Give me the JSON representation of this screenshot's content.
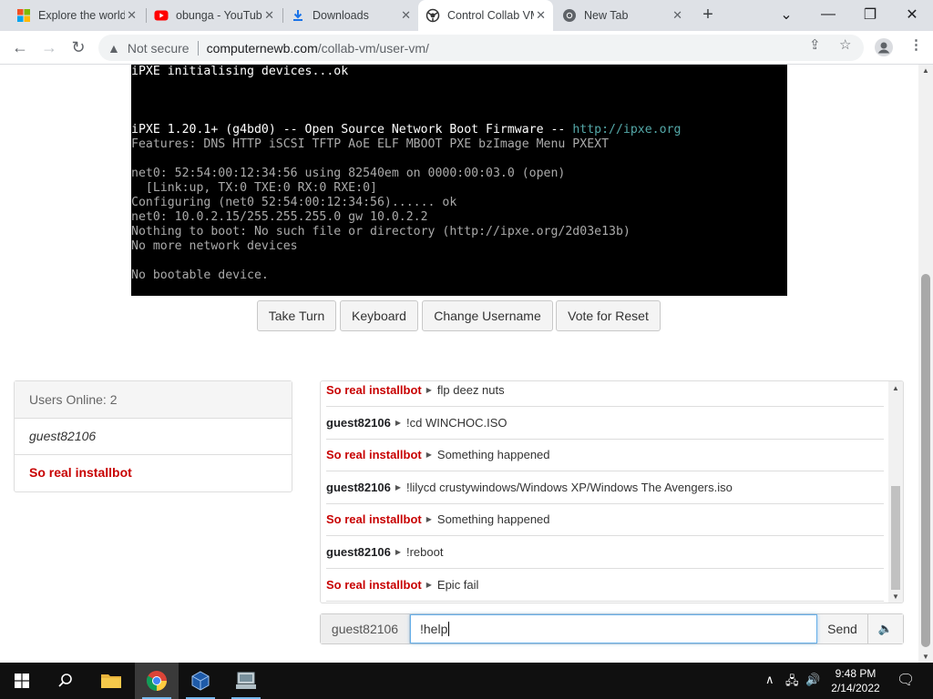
{
  "browser": {
    "tabs": [
      {
        "title": "Explore the world"
      },
      {
        "title": "obunga - YouTube"
      },
      {
        "title": "Downloads"
      },
      {
        "title": "Control Collab VM"
      },
      {
        "title": "New Tab"
      }
    ],
    "url_warning": "Not secure",
    "url_domain": "computernewb.com",
    "url_path": "/collab-vm/user-vm/"
  },
  "vm_console": {
    "lines": [
      "iPXE initialising devices...ok",
      "",
      "",
      "",
      "iPXE 1.20.1+ (g4bd0) -- Open Source Network Boot Firmware -- ",
      "Features: DNS HTTP iSCSI TFTP AoE ELF MBOOT PXE bzImage Menu PXEXT",
      "",
      "net0: 52:54:00:12:34:56 using 82540em on 0000:00:03.0 (open)",
      "  [Link:up, TX:0 TXE:0 RX:0 RXE:0]",
      "Configuring (net0 52:54:00:12:34:56)...... ok",
      "net0: 10.0.2.15/255.255.255.0 gw 10.0.2.2",
      "Nothing to boot: No such file or directory (http://ipxe.org/2d03e13b)",
      "No more network devices",
      "",
      "No bootable device."
    ],
    "link": "http://ipxe.org"
  },
  "buttons": {
    "take_turn": "Take Turn",
    "keyboard": "Keyboard",
    "change_username": "Change Username",
    "vote_reset": "Vote for Reset"
  },
  "users": {
    "header": "Users Online: 2",
    "list": [
      {
        "name": "guest82106"
      },
      {
        "name": "So real installbot"
      }
    ]
  },
  "chat": {
    "messages": [
      {
        "user": "So real installbot",
        "text": "flp deez nuts",
        "bot": true
      },
      {
        "user": "guest82106",
        "text": "!cd WINCHOC.ISO",
        "bot": false
      },
      {
        "user": "So real installbot",
        "text": "Something happened",
        "bot": true
      },
      {
        "user": "guest82106",
        "text": "!lilycd crustywindows/Windows XP/Windows The Avengers.iso",
        "bot": false
      },
      {
        "user": "So real installbot",
        "text": "Something happened",
        "bot": true
      },
      {
        "user": "guest82106",
        "text": "!reboot",
        "bot": false
      },
      {
        "user": "So real installbot",
        "text": "Epic fail",
        "bot": true
      }
    ],
    "username": "guest82106",
    "input_value": "!help",
    "send_label": "Send"
  },
  "taskbar": {
    "time": "9:48 PM",
    "date": "2/14/2022"
  },
  "colors": {
    "bot_name": "#c80000",
    "focus": "#66afe9"
  }
}
